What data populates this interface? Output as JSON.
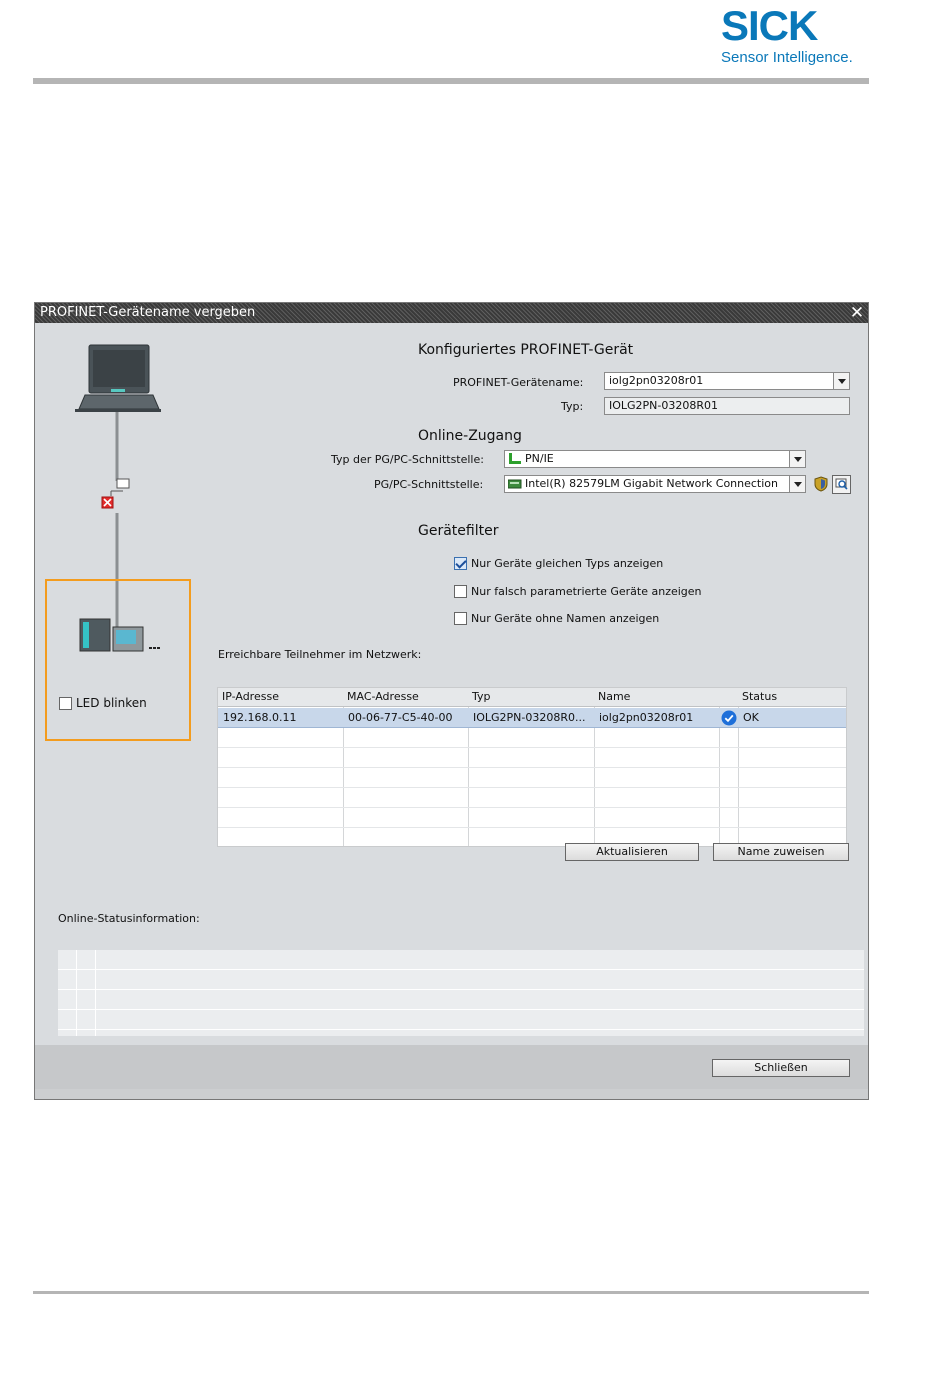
{
  "brand": {
    "name": "SICK",
    "tagline": "Sensor Intelligence."
  },
  "dialog": {
    "title": "PROFINET-Gerätename vergeben",
    "close_glyph": "✕",
    "configured": {
      "heading": "Konfiguriertes PROFINET-Gerät",
      "device_name_label": "PROFINET-Gerätename:",
      "device_name_value": "iolg2pn03208r01",
      "type_label": "Typ:",
      "type_value": "IOLG2PN-03208R01"
    },
    "online": {
      "heading": "Online-Zugang",
      "pgpc_type_label": "Typ der PG/PC-Schnittstelle:",
      "pgpc_type_value": "PN/IE",
      "pgpc_label": "PG/PC-Schnittstelle:",
      "pgpc_value": "Intel(R) 82579LM Gigabit Network Connection"
    },
    "filter": {
      "heading": "Gerätefilter",
      "options": [
        {
          "label": "Nur Geräte gleichen Typs anzeigen",
          "checked": true
        },
        {
          "label": "Nur falsch parametrierte Geräte anzeigen",
          "checked": false
        },
        {
          "label": "Nur Geräte ohne Namen anzeigen",
          "checked": false
        }
      ]
    },
    "network": {
      "label": "Erreichbare Teilnehmer im Netzwerk:",
      "columns": [
        "IP-Adresse",
        "MAC-Adresse",
        "Typ",
        "Name",
        "",
        "Status"
      ],
      "rows": [
        {
          "ip": "192.168.0.11",
          "mac": "00-06-77-C5-40-00",
          "type": "IOLG2PN-03208R0...",
          "name": "iolg2pn03208r01",
          "status_icon": "check-circle-icon",
          "status": "OK"
        }
      ]
    },
    "buttons": {
      "refresh": "Aktualisieren",
      "assign": "Name zuweisen",
      "close": "Schließen"
    },
    "led_label": "LED blinken",
    "status_label": "Online-Statusinformation:",
    "colors": {
      "accent_orange": "#f39c1e",
      "sick_blue": "#0a78b9",
      "ok_blue": "#1e6fd9"
    }
  }
}
